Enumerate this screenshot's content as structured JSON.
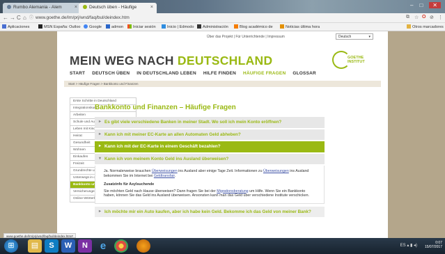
{
  "browser": {
    "tabs": [
      {
        "label": "Rumbo Alemania - Alem",
        "fav_color": "#6a7f99"
      },
      {
        "label": "Deutsch üben - Häufige",
        "fav_color": "#9ab913"
      }
    ],
    "url": "www.goethe.de/lrn/prj/wnd/faq/bul/deindex.htm",
    "bookmarks": [
      {
        "label": "Aplicaciones",
        "icon": "apps-grid-icon",
        "color": "#4a6fd1"
      },
      {
        "label": "MSN España: Outloo",
        "icon": "msn-icon",
        "color": "#222222"
      },
      {
        "label": "Google",
        "icon": "google-icon",
        "color": "#4285f4"
      },
      {
        "label": "admon",
        "icon": "admon-icon",
        "color": "#2a66c9"
      },
      {
        "label": "Iniciar sesión",
        "icon": "microsoft-icon",
        "color": "#e65b24"
      },
      {
        "label": "Inicio | Edmodo",
        "icon": "edmodo-icon",
        "color": "#2f8de0"
      },
      {
        "label": "Administración",
        "icon": "admin-icon",
        "color": "#333333"
      },
      {
        "label": "Blog académico de",
        "icon": "blogger-icon",
        "color": "#f57d00"
      },
      {
        "label": "Noticias última hora",
        "icon": "news-icon",
        "color": "#e39000"
      },
      {
        "label": "Otros marcadores",
        "icon": "folder-icon",
        "color": "#e3b341"
      }
    ]
  },
  "page": {
    "top_links": "Über das Projekt  |  Für Unterrichtende  |  Impressum",
    "language": "Deutsch",
    "title_gray": "MEIN WEG NACH",
    "title_green": "DEUTSCHLAND",
    "logo_text_1": "GOETHE",
    "logo_text_2": "INSTITUT",
    "nav": [
      "START",
      "DEUTSCH ÜBEN",
      "IN DEUTSCHLAND LEBEN",
      "HILFE FINDEN",
      "HÄUFIGE FRAGEN",
      "GLOSSAR"
    ],
    "nav_active_index": 4,
    "breadcrumb": "Start  >  Häufige Fragen  >  Bankkonto und Finanzen"
  },
  "sidebar": [
    "Erste Schritte in Deutschland",
    "Integrationskurs",
    "Arbeiten",
    "Schule und Ausbildung",
    "Leben mit Kindern",
    "Heirat",
    "Gesundheit",
    "Wohnen",
    "Einkaufen",
    "Freizeit",
    "Grundrechte und öffentliches Leben",
    "Unterwegs in der Stadt",
    "Bankkonto und Finanzen",
    "Versicherungen",
    "Online-Wörterbücher"
  ],
  "sidebar_active_index": 12,
  "faq": {
    "heading": "Bankkonto und Finanzen – Häufige Fragen",
    "questions": [
      "Es gibt viele verschiedene Banken in meiner Stadt. Wo soll ich mein Konto eröffnen?",
      "Kann ich mit meiner EC-Karte an allen Automaten Geld abheben?",
      "Kann ich mit der EC-Karte in einem Geschäft bezahlen?",
      "Kann ich von meinem Konto Geld ins Ausland überweisen?",
      "Ich möchte mir ein Auto kaufen, aber ich habe kein Geld. Bekomme ich das Geld von meiner Bank?"
    ],
    "answer": {
      "p1_a": "Ja. Normalerweise brauchen ",
      "p1_link1": "Überweisungen",
      "p1_b": " ins Ausland aber einige Tage Zeit. Informationen zu ",
      "p1_link2": "Überweisungen",
      "p1_c": " ins Ausland bekommen Sie im Internet bei ",
      "p1_link3": "Geldtransfair",
      "p1_d": ".",
      "sub_heading": "Zusatzinfo für Asylsuchende",
      "p2_a": "Sie möchten Geld nach Hause überweisen? Dann fragen Sie bei der ",
      "p2_link": "Migrationsberatung",
      "p2_b": " um Hilfe. Wenn Sie ein Bankkonto haben, können Sie das Geld ins Ausland überweisen. Ansonsten kann man das Geld über verschiedene Institute verschicken."
    }
  },
  "status_url": "www.goethe.de/lrn/prj/wnd/faq/bul/deindex.htm#",
  "taskbar": {
    "lang": "ES",
    "time": "0:07",
    "date": "15/07/2017"
  }
}
